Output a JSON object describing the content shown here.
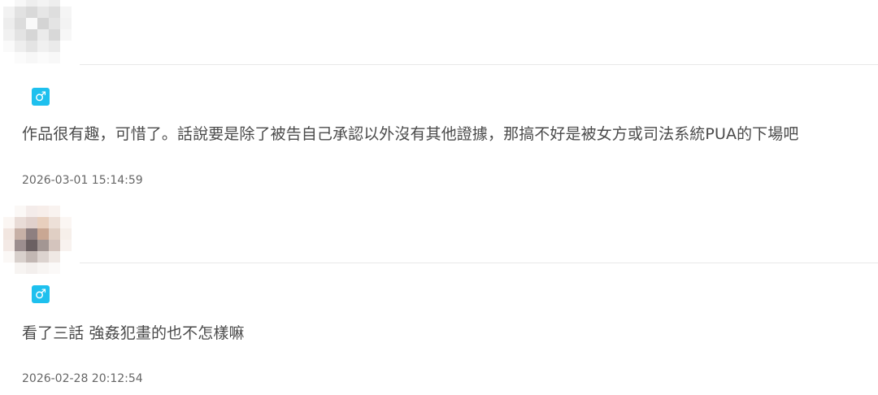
{
  "comments": [
    {
      "gender_icon": "♂",
      "text": "作品很有趣，可惜了。話說要是除了被告自己承認以外沒有其他證據，那搞不好是被女方或司法系統PUA的下場吧",
      "timestamp": "2026-03-01 15:14:59",
      "avatar_pixels": [
        "#ffffff",
        "#f7f7f7",
        "#eeeeee",
        "#f3f3f3",
        "#eeeeee",
        "#ffffff",
        "#f2f2f2",
        "#e2e2e2",
        "#d9d9d9",
        "#e6e6e6",
        "#dedede",
        "#f5f5f5",
        "#ededed",
        "#dcdcdc",
        "#f9f9f9",
        "#d4d4d4",
        "#e4e4e4",
        "#f3f3f3",
        "#f1f1f1",
        "#e3e3e3",
        "#d6d6d6",
        "#ebebeb",
        "#d8d8d8",
        "#f7f7f7",
        "#fafafa",
        "#eeeeee",
        "#e4e4e4",
        "#f0f0f0",
        "#eaeaea",
        "#ffffff",
        "#ffffff",
        "#fbfbfb",
        "#f7f7f7",
        "#fbfbfb",
        "#f8f8f8",
        "#ffffff"
      ]
    },
    {
      "gender_icon": "♂",
      "text": "看了三話 強姦犯畫的也不怎樣嘛",
      "timestamp": "2026-02-28 20:12:54",
      "avatar_pixels": [
        "#ffffff",
        "#fbf8f6",
        "#f4ecea",
        "#f7eeea",
        "#f9f3f0",
        "#ffffff",
        "#fbf6f3",
        "#e9dcd7",
        "#e1d1cc",
        "#e8cfbd",
        "#ede0d8",
        "#fbf6f3",
        "#f2e6e0",
        "#c7b0a6",
        "#8e7f80",
        "#c9a793",
        "#e0cfc4",
        "#f6efea",
        "#f3e9e5",
        "#9c8e8f",
        "#6b6062",
        "#a39693",
        "#d4c4bd",
        "#f8f2ef",
        "#fbf8f6",
        "#d8d0cc",
        "#c2b7b3",
        "#dcd3cf",
        "#efe8e4",
        "#ffffff",
        "#ffffff",
        "#f7f4f2",
        "#f3efed",
        "#f8f5f3",
        "#fbf9f8",
        "#ffffff"
      ]
    }
  ]
}
